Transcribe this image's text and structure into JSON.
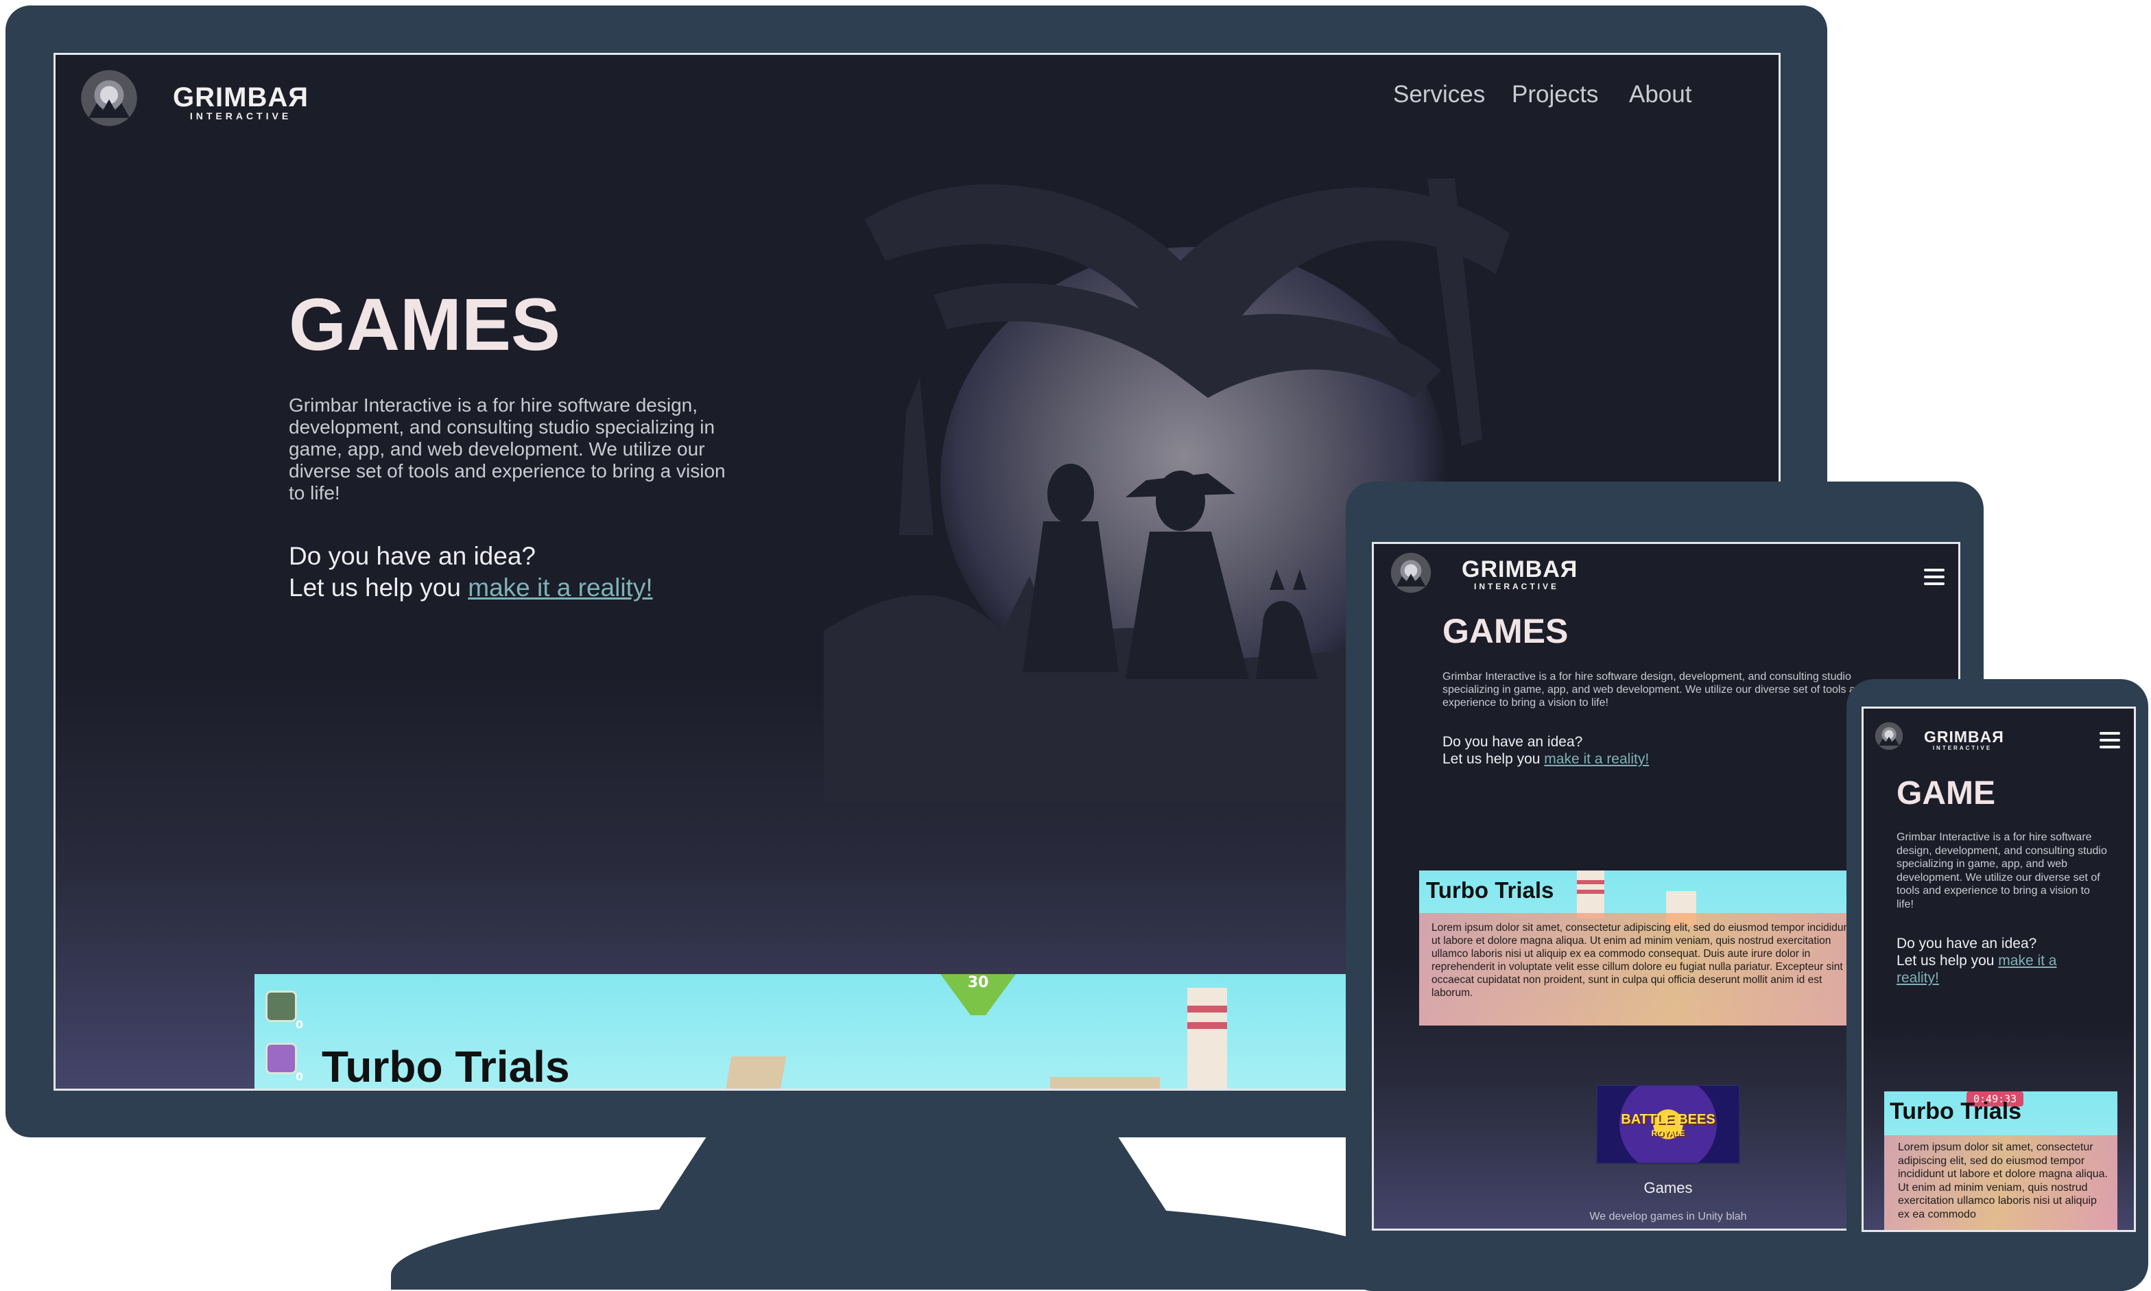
{
  "brand": {
    "name": "GRIMBAЯ",
    "tagline": "INTERACTIVE"
  },
  "nav": {
    "items": [
      "Services",
      "Projects",
      "About"
    ]
  },
  "desktop": {
    "hero_title": "GAMES",
    "description": "Grimbar Interactive is a for hire software design, development, and consulting studio specializing in game, app, and web development. We utilize our diverse set of tools and experience to bring a vision to life!",
    "cta_line1": "Do you have an idea?",
    "cta_prefix": "Let us help you ",
    "cta_link": "make it a reality!",
    "card_title": "Turbo Trials",
    "hud_count_1": "0",
    "hud_count_2": "0",
    "gem_value": "30"
  },
  "tablet": {
    "hero_title": "GAMES",
    "description": "Grimbar Interactive is a for hire software design, development, and consulting studio specializing in game, app, and web development. We utilize our diverse set of tools and experience to bring a vision to life!",
    "cta_line1": "Do you have an idea?",
    "cta_prefix": "Let us help you ",
    "cta_link": "make it a reality!",
    "card_title": "Turbo Trials",
    "card_text": "Lorem ipsum dolor sit amet, consectetur adipiscing elit, sed do eiusmod tempor incididunt ut labore et dolore magna aliqua. Ut enim ad minim veniam, quis nostrud exercitation ullamco laboris nisi ut aliquip ex ea commodo consequat. Duis aute irure dolor in reprehenderit in voluptate velit esse cillum dolore eu fugiat nulla pariatur. Excepteur sint occaecat cupidatat non proident, sunt in culpa qui officia deserunt mollit anim id est laborum.",
    "thumb_title": "BATTLE BEES",
    "thumb_subtitle": "ROYALE",
    "section_title": "Games",
    "section_desc": "We develop games in Unity blah"
  },
  "phone": {
    "hero_title": "GAME",
    "description": "Grimbar Interactive is a for hire software design, development, and consulting studio specializing in game, app, and web development. We utilize our diverse set of tools and experience to bring a vision to life!",
    "cta_line1": "Do you have an idea?",
    "cta_prefix": "Let us help you ",
    "cta_link": "make it a reality!",
    "card_title": "Turbo Trials",
    "card_text": "Lorem ipsum dolor sit amet, consectetur adipiscing elit, sed do eiusmod tempor incididunt ut labore et dolore magna aliqua. Ut enim ad minim veniam, quis nostrud exercitation ullamco laboris nisi ut aliquip ex ea commodo",
    "timer": "0:49:33"
  },
  "colors": {
    "frame": "#2d3f50",
    "screen_bg": "#1b1d29",
    "link": "#7fb3b7",
    "title": "#f1e4e4"
  }
}
